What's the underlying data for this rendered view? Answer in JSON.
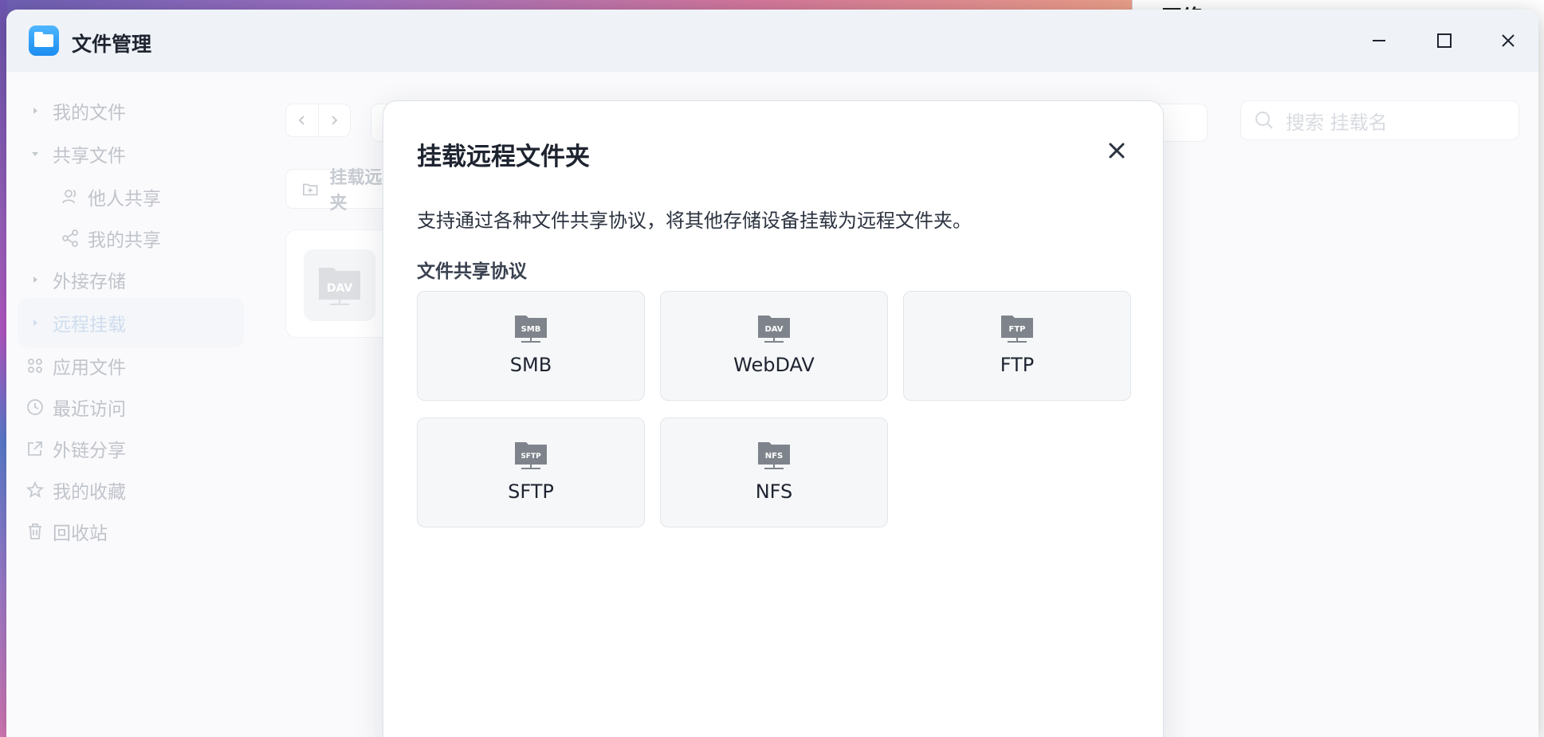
{
  "app": {
    "title": "文件管理",
    "logo_icon": "folder-icon",
    "accent": "#1b8df0"
  },
  "background_window": {
    "title": "网络"
  },
  "sidebar": {
    "items": [
      {
        "label": "我的文件",
        "icon": "caret-right-icon"
      },
      {
        "label": "共享文件",
        "icon": "caret-down-icon"
      },
      {
        "label": "他人共享",
        "icon": "users-icon"
      },
      {
        "label": "我的共享",
        "icon": "share-icon"
      },
      {
        "label": "外接存储",
        "icon": "caret-right-icon"
      },
      {
        "label": "远程挂载",
        "icon": "caret-right-icon"
      },
      {
        "label": "应用文件",
        "icon": "apps-icon"
      },
      {
        "label": "最近访问",
        "icon": "clock-icon"
      },
      {
        "label": "外链分享",
        "icon": "external-share-icon"
      },
      {
        "label": "我的收藏",
        "icon": "star-icon"
      },
      {
        "label": "回收站",
        "icon": "trash-icon"
      }
    ]
  },
  "toolbar": {
    "search_placeholder": "搜索 挂载名",
    "mount_button_label": "挂载远程文件夹"
  },
  "mount_card": {
    "badge": "DAV"
  },
  "dialog": {
    "title": "挂载远程文件夹",
    "description": "支持通过各种文件共享协议，将其他存储设备挂载为远程文件夹。",
    "section_title": "文件共享协议",
    "protocols": [
      {
        "label": "SMB",
        "badge": "SMB"
      },
      {
        "label": "WebDAV",
        "badge": "DAV"
      },
      {
        "label": "FTP",
        "badge": "FTP"
      },
      {
        "label": "SFTP",
        "badge": "SFTP"
      },
      {
        "label": "NFS",
        "badge": "NFS"
      }
    ]
  }
}
